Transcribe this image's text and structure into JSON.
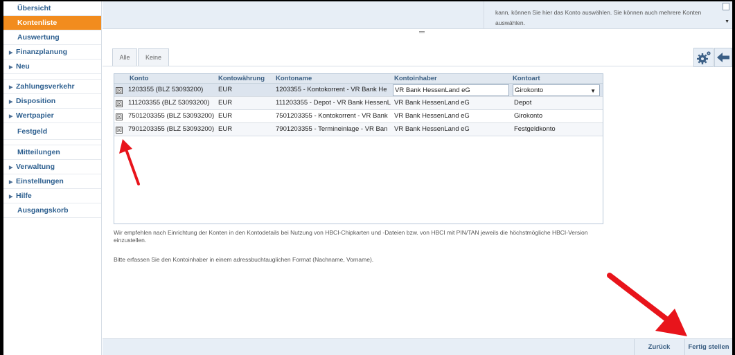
{
  "sidebar": {
    "items": [
      {
        "label": "Übersicht",
        "arrow": false,
        "active": false
      },
      {
        "label": "Kontenliste",
        "arrow": false,
        "active": true
      },
      {
        "label": "Auswertung",
        "arrow": false,
        "active": false
      },
      {
        "label": "Finanzplanung",
        "arrow": true,
        "active": false
      },
      {
        "label": "Neu",
        "arrow": true,
        "active": false
      },
      {
        "label": "Zahlungsverkehr",
        "arrow": true,
        "active": false
      },
      {
        "label": "Disposition",
        "arrow": true,
        "active": false
      },
      {
        "label": "Wertpapier",
        "arrow": true,
        "active": false
      },
      {
        "label": "Festgeld",
        "arrow": false,
        "active": false
      },
      {
        "label": "Mitteilungen",
        "arrow": false,
        "active": false
      },
      {
        "label": "Verwaltung",
        "arrow": true,
        "active": false
      },
      {
        "label": "Einstellungen",
        "arrow": true,
        "active": false
      },
      {
        "label": "Hilfe",
        "arrow": true,
        "active": false
      },
      {
        "label": "Ausgangskorb",
        "arrow": false,
        "active": false
      }
    ]
  },
  "topbar": {
    "hint_text": "kann, können Sie hier das Konto auswählen. Sie können auch mehrere Konten auswählen."
  },
  "tabs": {
    "alle": "Alle",
    "keine": "Keine"
  },
  "table": {
    "columns": [
      "Konto",
      "Kontowährung",
      "Kontoname",
      "Kontoinhaber",
      "Kontoart"
    ],
    "rows": [
      {
        "checked": "☒",
        "konto": "1203355 (BLZ 53093200)",
        "waehrung": "EUR",
        "name": "1203355 - Kontokorrent - VR Bank He",
        "inhaber": "VR Bank HessenLand eG",
        "art": "Girokonto"
      },
      {
        "checked": "☒",
        "konto": "111203355 (BLZ 53093200)",
        "waehrung": "EUR",
        "name": "111203355 - Depot - VR Bank HessenL",
        "inhaber": "VR Bank HessenLand eG",
        "art": "Depot"
      },
      {
        "checked": "☒",
        "konto": "7501203355 (BLZ 53093200)",
        "waehrung": "EUR",
        "name": "7501203355 - Kontokorrent - VR Bank",
        "inhaber": "VR Bank HessenLand eG",
        "art": "Girokonto"
      },
      {
        "checked": "☒",
        "konto": "7901203355 (BLZ 53093200)",
        "waehrung": "EUR",
        "name": "7901203355 - Termineinlage - VR Ban",
        "inhaber": "VR Bank HessenLand eG",
        "art": "Festgeldkonto"
      }
    ]
  },
  "info": {
    "line1": "Wir empfehlen nach Einrichtung der Konten in den Kontodetails bei Nutzung von HBCI-Chipkarten und -Dateien bzw. von HBCI mit PIN/TAN jeweils die höchstmögliche HBCI-Version einzustellen.",
    "line2": "Bitte erfassen Sie den Kontoinhaber in einem adressbuchtauglichen Format (Nachname, Vorname)."
  },
  "footer": {
    "back_label": "Zurück",
    "finish_label": "Fertig stellen"
  },
  "colors": {
    "accent": "#f28c1e",
    "nav_text": "#2d5f8f",
    "annotation_arrow": "#e8141b"
  },
  "icons": {
    "toolbar": [
      "gear-icon",
      "arrow-left-icon"
    ],
    "annotations": [
      "red-arrow-up-icon",
      "red-arrow-down-right-icon"
    ]
  }
}
